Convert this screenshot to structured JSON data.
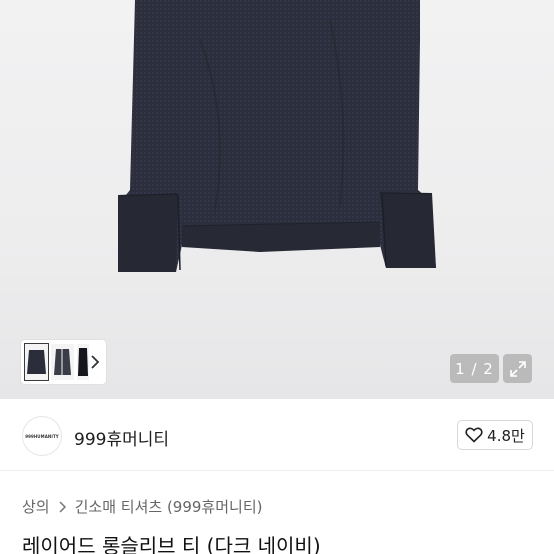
{
  "gallery": {
    "pager_text": "1 / 2",
    "image_subject": "dark navy long sleeve layered tee",
    "garment_color": "#2b2d3a",
    "icons": {
      "next": "chevron-right-icon",
      "zoom": "expand-icon"
    }
  },
  "store": {
    "logo_text": "999HUMANITY",
    "name": "999휴머니티",
    "rating": "4.8만",
    "rating_icon": "heart-icon"
  },
  "breadcrumb": {
    "level1": "상의",
    "level2": "긴소매 티셔츠 (999휴머니티)"
  },
  "product": {
    "title": "레이어드 롱슬리브 티 (다크 네이비)"
  }
}
